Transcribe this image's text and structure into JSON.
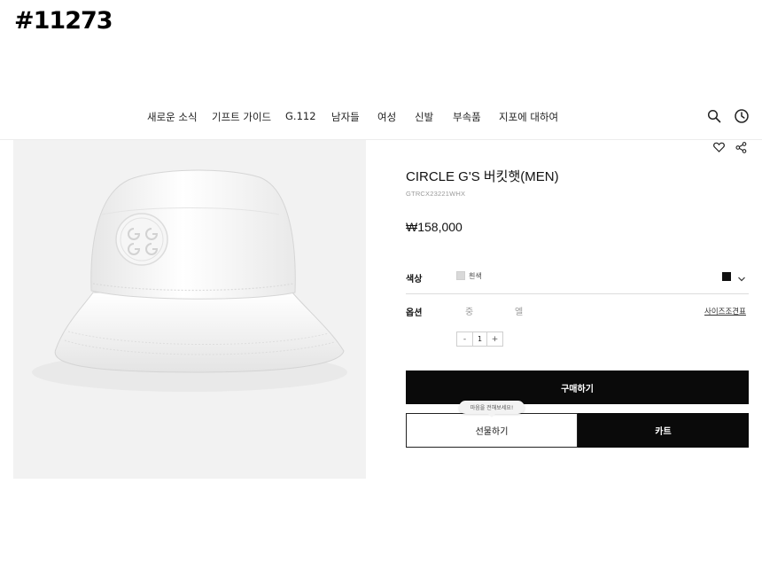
{
  "stamp": "#11273",
  "nav": {
    "items": [
      "새로운 소식",
      "기프트 가이드",
      "G.112",
      "남자들",
      "여성",
      "신발",
      "부속품",
      "지포에 대하여"
    ],
    "icons": [
      "search-icon",
      "clock-icon"
    ]
  },
  "product": {
    "title": "CIRCLE G'S 버킷햇(MEN)",
    "code": "GTRCX23221WHX",
    "price": "₩158,000",
    "image": "white-bucket-hat",
    "icons": [
      "heart-icon",
      "share-icon"
    ]
  },
  "color_row": {
    "label": "색상",
    "selected_name": "흰색",
    "selected_color": "#d9d9d9",
    "alt_color": "#111111"
  },
  "option_row": {
    "label": "옵션",
    "sizes": [
      "중",
      "엘"
    ],
    "size_guide": "사이즈조견표"
  },
  "quantity": {
    "minus": "-",
    "value": "1",
    "plus": "+"
  },
  "actions": {
    "buy": "구매하기",
    "gift": "선물하기",
    "gift_tooltip": "마음을 전해보세요!",
    "cart": "카트"
  },
  "colors": {
    "primary_button": "#0a0a0a",
    "photo_bg": "#f2f2f2"
  }
}
